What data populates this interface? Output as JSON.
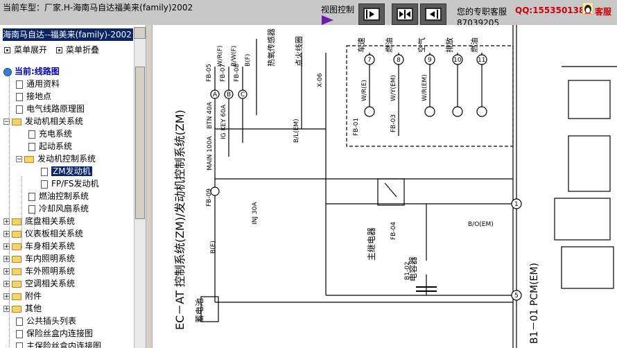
{
  "header": {
    "car_model": "当前车型：厂家.H-海南马自达福美来(family)2002",
    "view_control_label": "视图控制",
    "support_label": "您的专职客服",
    "support_phone": "87039205",
    "qq": "QQ:1553501388",
    "service_label": "客服"
  },
  "left_pane": {
    "title": "海南马自达--福美来(family)-2002",
    "menu_expand": "菜单展开",
    "menu_collapse": "菜单折叠",
    "tree": [
      {
        "label": "当前:线路图"
      },
      {
        "label": "通用资料"
      },
      {
        "label": "接地点"
      },
      {
        "label": "电气线路原理图"
      },
      {
        "label": "发动机相关系统"
      },
      {
        "label": "充电系统"
      },
      {
        "label": "起动系统"
      },
      {
        "label": "发动机控制系统"
      },
      {
        "label": "ZM发动机"
      },
      {
        "label": "FP/FS发动机"
      },
      {
        "label": "燃油控制系统"
      },
      {
        "label": "冷却风扇系统"
      },
      {
        "label": "底盘相关系统"
      },
      {
        "label": "仪表板相关系统"
      },
      {
        "label": "车身相关系统"
      },
      {
        "label": "车内照明系统"
      },
      {
        "label": "车外照明系统"
      },
      {
        "label": "空调相关系统"
      },
      {
        "label": "附件"
      },
      {
        "label": "其他"
      },
      {
        "label": "公共插头列表"
      },
      {
        "label": "保险丝盒内连接图"
      },
      {
        "label": "主保险丝盒内连接图"
      }
    ]
  },
  "diagram": {
    "main_title": "EC－AT 控制系统(ZM)/发动机控制系统(ZM)",
    "pcm_label": "B1－01 PCM(EM)",
    "battery_label": "蓄电池",
    "relay_label": "主继电器",
    "relay_ref": "FB-04",
    "capacitor_label": "电容器",
    "capacitor_ref": "B1-02",
    "inj_fuse": "INJ 30A",
    "main_fuse": "MAIN 100A",
    "btn_fuse": "BTN 40A",
    "igkey_fuse": "IG KEY 60A",
    "connector_refs": [
      "FB-05",
      "FB-07",
      "FB-08",
      "FB-09",
      "FB-01",
      "FB-03",
      "X-06"
    ],
    "wire_codes": [
      "W/R(F)",
      "B/W(F)",
      "B(F)",
      "B/L(EM)",
      "W/R(E)",
      "W/Y(EM)",
      "W/R(EM)",
      "B/O(EM)",
      "B(E)"
    ],
    "circle_refs": [
      "7",
      "8",
      "9",
      "10",
      "11",
      "12",
      "13",
      "1",
      "5"
    ],
    "side_notes": [
      "热氧传感器",
      "点火线圈",
      "参见B",
      "车速",
      "燃油",
      "空气",
      "排放",
      "燃油"
    ],
    "letters": [
      "A",
      "B",
      "C",
      "D",
      "K",
      "M",
      "N",
      "O",
      "T",
      "S"
    ]
  }
}
